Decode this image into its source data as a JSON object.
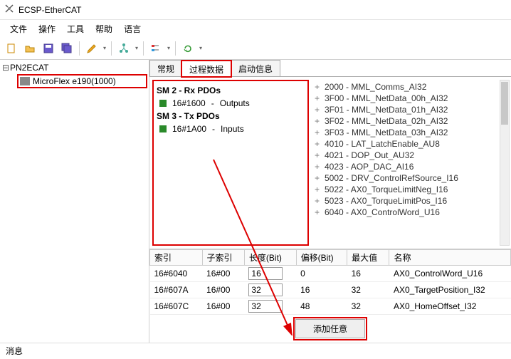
{
  "window": {
    "title": "ECSP-EtherCAT"
  },
  "menu": {
    "file": "文件",
    "action": "操作",
    "tools": "工具",
    "help": "帮助",
    "lang": "语言"
  },
  "tree": {
    "root": "PN2ECAT",
    "child": "MicroFlex e190(1000)"
  },
  "tabs": {
    "t1": "常规",
    "t2": "过程数据",
    "t3": "启动信息"
  },
  "pdo": {
    "sm2": "SM 2 - Rx PDOs",
    "sm2_idx": "16#1600",
    "sm2_name": "Outputs",
    "sm3": "SM 3 - Tx PDOs",
    "sm3_idx": "16#1A00",
    "sm3_name": "Inputs",
    "dash": "-"
  },
  "objects": [
    "2000 - MML_Comms_AI32",
    "3F00 - MML_NetData_00h_AI32",
    "3F01 - MML_NetData_01h_AI32",
    "3F02 - MML_NetData_02h_AI32",
    "3F03 - MML_NetData_03h_AI32",
    "4010 - LAT_LatchEnable_AU8",
    "4021 - DOP_Out_AU32",
    "4023 - AOP_DAC_AI16",
    "5002 - DRV_ControlRefSource_I16",
    "5022 - AX0_TorqueLimitNeg_I16",
    "5023 - AX0_TorqueLimitPos_I16",
    "6040 - AX0_ControlWord_U16"
  ],
  "table": {
    "headers": {
      "idx": "索引",
      "sub": "子索引",
      "len": "长度(Bit)",
      "off": "偏移(Bit)",
      "max": "最大值",
      "name": "名称"
    },
    "rows": [
      {
        "idx": "16#6040",
        "sub": "16#00",
        "len": "16",
        "off": "0",
        "max": "16",
        "name": "AX0_ControlWord_U16"
      },
      {
        "idx": "16#607A",
        "sub": "16#00",
        "len": "32",
        "off": "16",
        "max": "32",
        "name": "AX0_TargetPosition_I32"
      },
      {
        "idx": "16#607C",
        "sub": "16#00",
        "len": "32",
        "off": "48",
        "max": "32",
        "name": "AX0_HomeOffset_I32"
      }
    ]
  },
  "button": {
    "add": "添加任意"
  },
  "status": {
    "msg": "消息"
  }
}
